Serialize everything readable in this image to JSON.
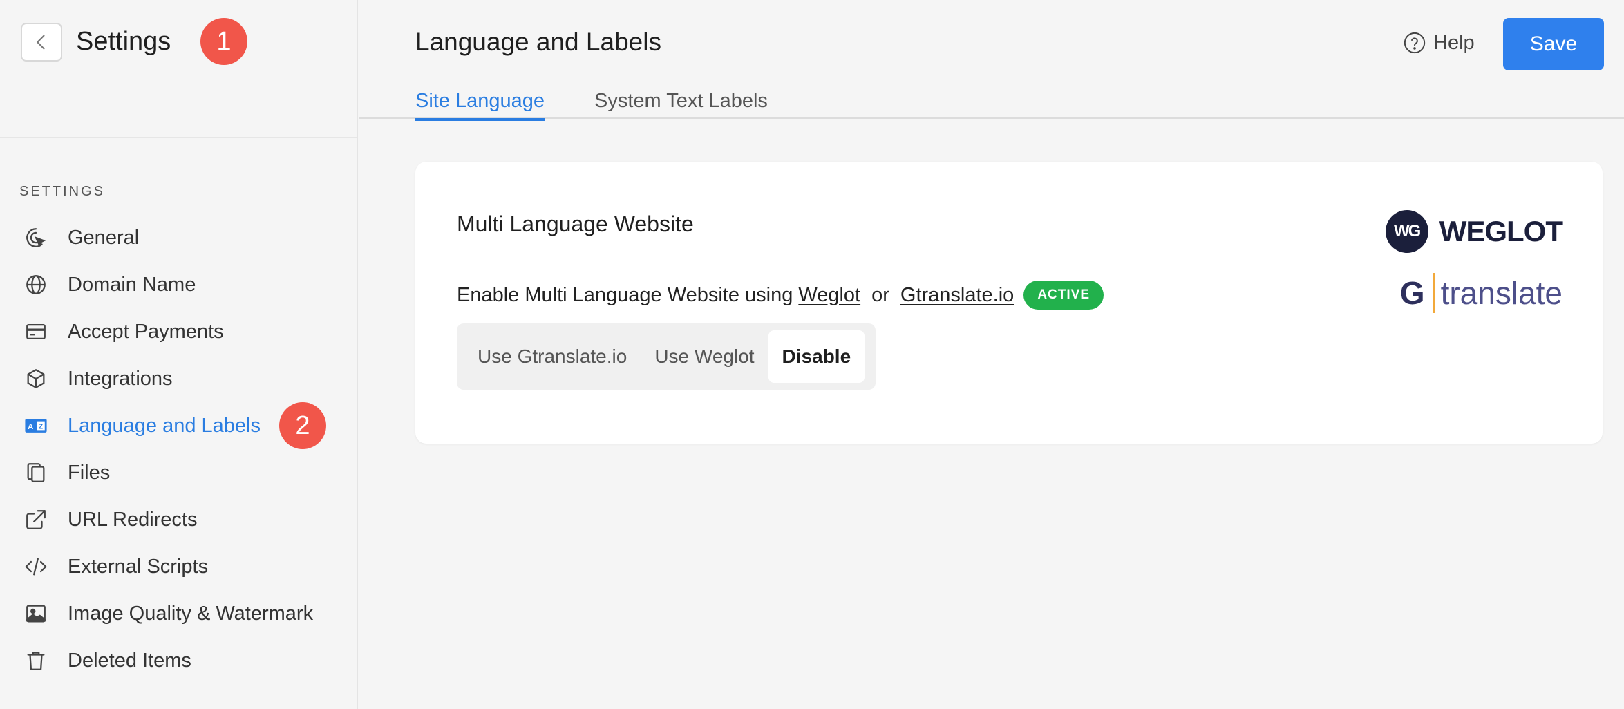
{
  "sidebar": {
    "title": "Settings",
    "badge_1": "1",
    "badge_2": "2",
    "section_label": "SETTINGS",
    "items": [
      {
        "label": "General",
        "icon": "target-cursor-icon"
      },
      {
        "label": "Domain Name",
        "icon": "globe-icon"
      },
      {
        "label": "Accept Payments",
        "icon": "credit-card-icon"
      },
      {
        "label": "Integrations",
        "icon": "cube-icon"
      },
      {
        "label": "Language and Labels",
        "icon": "translate-icon",
        "active": true
      },
      {
        "label": "Files",
        "icon": "files-icon"
      },
      {
        "label": "URL Redirects",
        "icon": "external-link-icon"
      },
      {
        "label": "External Scripts",
        "icon": "code-icon"
      },
      {
        "label": "Image Quality & Watermark",
        "icon": "image-icon"
      },
      {
        "label": "Deleted Items",
        "icon": "trash-icon"
      }
    ]
  },
  "header": {
    "title": "Language and Labels",
    "help_label": "Help",
    "save_label": "Save"
  },
  "tabs": [
    {
      "label": "Site Language",
      "active": true
    },
    {
      "label": "System Text Labels",
      "active": false
    }
  ],
  "card": {
    "title": "Multi Language Website",
    "enable_text": "Enable Multi Language Website using",
    "link_weglot": "Weglot",
    "or_text": "or",
    "link_gtranslate": "Gtranslate.io",
    "status_badge": "ACTIVE",
    "options": [
      {
        "label": "Use Gtranslate.io",
        "selected": false
      },
      {
        "label": "Use Weglot",
        "selected": false
      },
      {
        "label": "Disable",
        "selected": true
      }
    ],
    "weglot_logo_mark": "WG",
    "weglot_logo_text": "WEGLOT",
    "gtranslate_logo_mark": "G",
    "gtranslate_logo_text": "translate"
  },
  "colors": {
    "accent": "#2a7de1",
    "save_button": "#2f80ed",
    "badge": "#f1564a",
    "active_status": "#22b14c"
  }
}
